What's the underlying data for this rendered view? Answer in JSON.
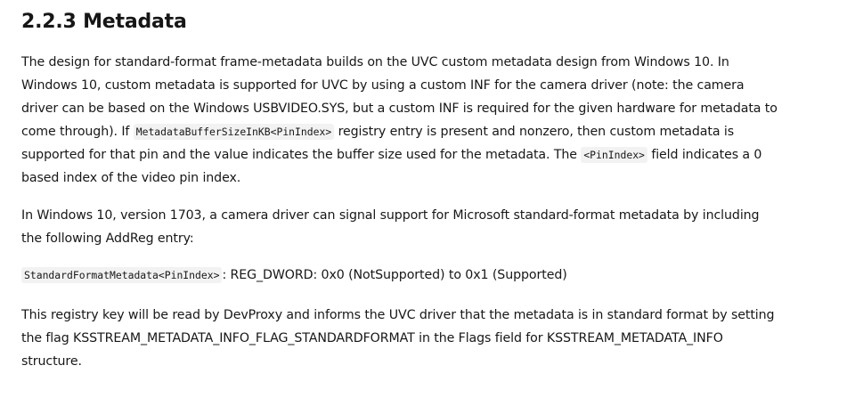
{
  "section": {
    "heading": "2.2.3 Metadata"
  },
  "paragraph1": {
    "text_a": "The design for standard-format frame-metadata builds on the UVC custom metadata design from Windows 10. In Windows 10, custom metadata is supported for UVC by using a custom INF for the camera driver (note: the camera driver can be based on the Windows USBVIDEO.SYS, but a custom INF is required for the given hardware for metadata to come through). If ",
    "code_a": "MetadataBufferSizeInKB<PinIndex>",
    "text_b": " registry entry is present and nonzero, then custom metadata is supported for that pin and the value indicates the buffer size used for the metadata. The ",
    "code_b": "<PinIndex>",
    "text_c": " field indicates a 0 based index of the video pin index."
  },
  "paragraph2": {
    "text": "In Windows 10, version 1703, a camera driver can signal support for Microsoft standard-format metadata by including the following AddReg entry:"
  },
  "paragraph3": {
    "code": "StandardFormatMetadata<PinIndex>",
    "text": ": REG_DWORD: 0x0 (NotSupported) to 0x1 (Supported)"
  },
  "paragraph4": {
    "text": "This registry key will be read by DevProxy and informs the UVC driver that the metadata is in standard format by setting the flag KSSTREAM_METADATA_INFO_FLAG_STANDARDFORMAT in the Flags field for KSSTREAM_METADATA_INFO structure."
  }
}
